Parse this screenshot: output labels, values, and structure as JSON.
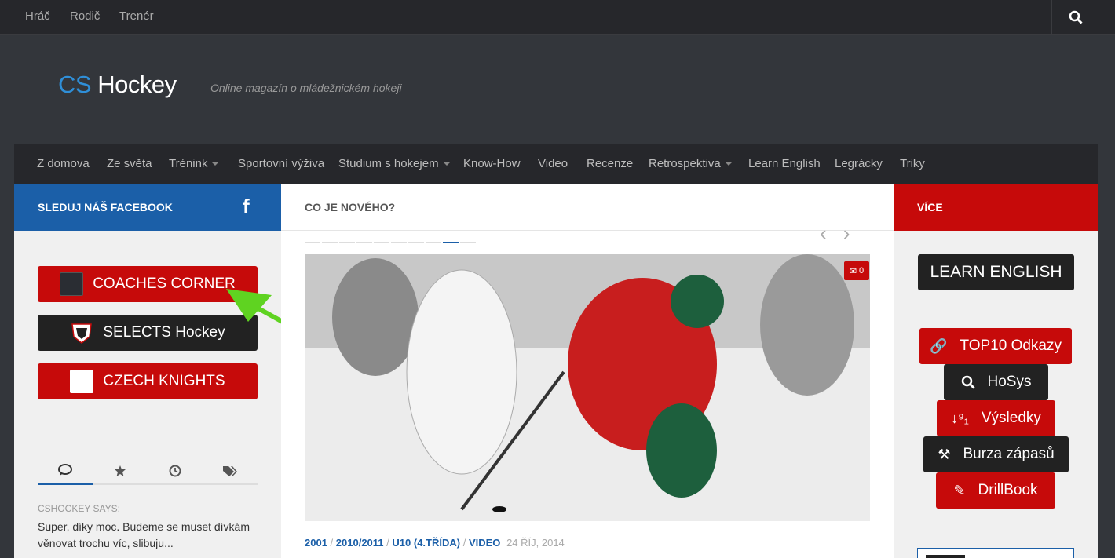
{
  "topbar": {
    "links": [
      "Hráč",
      "Rodič",
      "Trenér"
    ]
  },
  "logo": {
    "cs": "CS",
    "hockey": "Hockey",
    "tagline": "Online magazín o mládežnickém hokeji"
  },
  "nav": [
    "Z domova",
    "Ze světa",
    "Trénink",
    "Sportovní výživa",
    "Studium s hokejem",
    "Know-How",
    "Video",
    "Recenze",
    "Retrospektiva",
    "Learn English",
    "Legrácky",
    "Triky"
  ],
  "left": {
    "title": "SLEDUJ NÁŠ FACEBOOK",
    "fb": "f",
    "buttons": [
      "COACHES CORNER",
      "SELECTS Hockey",
      "CZECH KNIGHTS"
    ],
    "comment_author": "CSHOCKEY SAYS:",
    "comment_text": "Super, díky moc. Budeme se muset dívkám věnovat trochu víc, slibuju..."
  },
  "middle": {
    "title": "CO JE NOVÉHO?",
    "comment_count": "0",
    "meta": {
      "cats": [
        "2001",
        "2010/2011",
        "U10 (4.TŘÍDA)",
        "VIDEO"
      ],
      "date": "24 ŘÍJ, 2014"
    }
  },
  "right": {
    "title": "VÍCE",
    "buttons": [
      "LEARN ENGLISH",
      "TOP10 Odkazy",
      "HoSys",
      "Výsledky",
      "Burza zápasů",
      "DrillBook"
    ]
  },
  "colors": {
    "brand_blue": "#1b5fa8",
    "brand_red": "#c60a0a",
    "dark": "#26272b"
  }
}
